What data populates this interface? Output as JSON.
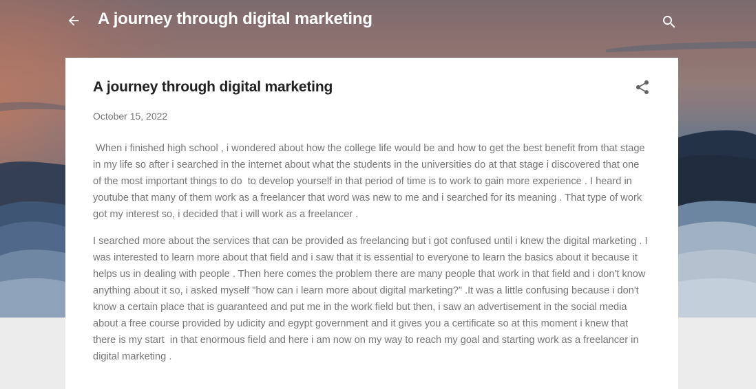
{
  "header": {
    "blog_title": "A journey through digital marketing",
    "back_icon": "arrow-back-icon",
    "search_icon": "search-icon"
  },
  "post": {
    "title": "A journey through digital marketing",
    "date": "October 15, 2022",
    "share_icon": "share-icon",
    "paragraphs": [
      " When i finished high school , i wondered about how the college life would be and how to get the best benefit from that stage in my life so after i searched in the internet about what the students in the universities do at that stage i discovered that one of the most important things to do  to develop yourself in that period of time is to work to gain more experience . I heard in youtube that many of them work as a freelancer that word was new to me and i searched for its meaning . That type of work got my interest so, i decided that i will work as a freelancer .",
      "I searched more about the services that can be provided as freelancing but i got confused until i knew the digital marketing . I was interested to learn more about that field and i saw that it is essential to everyone to learn the basics about it because it helps us in dealing with people . Then here comes the problem there are many people that work in that field and i don't know anything about it so, i asked myself \"how can i learn more about digital marketing?\" .It was a little confusing because i don't know a certain place that is guaranteed and put me in the work field but then, i saw an advertisement in the social media about a free course provided by udicity and egypt government and it gives you a certificate so at this moment i knew that there is my start  in that enormous field and here i am now on my way to reach my goal and starting work as a freelancer in digital marketing ."
    ]
  },
  "colors": {
    "title_text": "#212121",
    "body_text": "#757575",
    "header_text": "#ffffff",
    "page_background": "#ececec",
    "card_background": "#ffffff"
  }
}
